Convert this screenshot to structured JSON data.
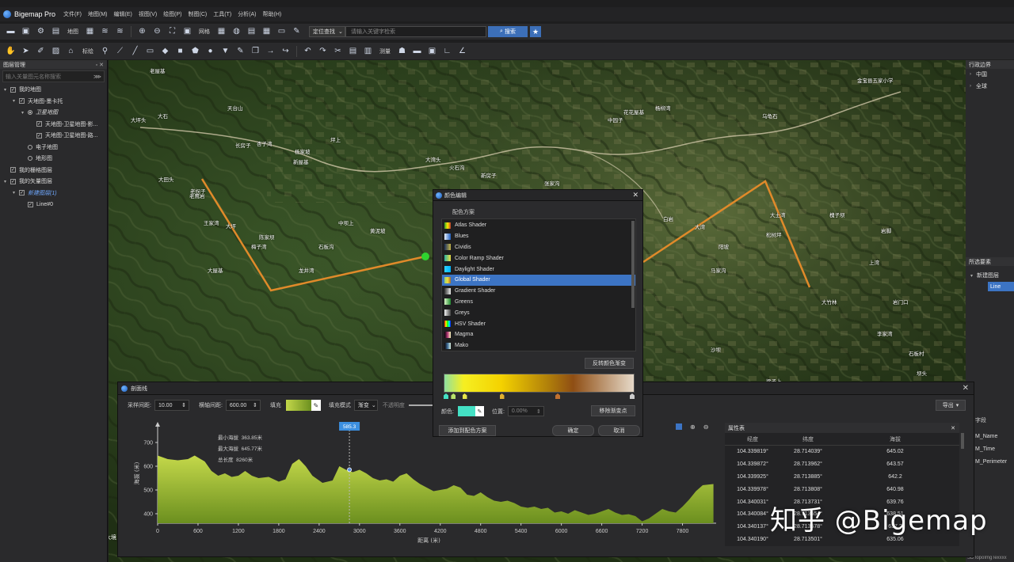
{
  "app": {
    "title": "Bigemap Pro",
    "menu": [
      "文件(F)",
      "地图(M)",
      "编辑(E)",
      "视图(V)",
      "绘图(P)",
      "制图(C)",
      "工具(T)",
      "分析(A)",
      "帮助(H)"
    ]
  },
  "toolbar1": {
    "map_label": "地图",
    "grid_label": "网格",
    "search_mode": "定位查找",
    "search_placeholder": "请输入关键字检索",
    "search_button": "搜索",
    "star_icon": "★"
  },
  "toolbar2": {
    "mark_label": "标绘",
    "measure_label": "测量"
  },
  "left_panel": {
    "title": "图层管理",
    "filter_placeholder": "输入关量图元名称搜索",
    "tree": [
      {
        "label": "我的地图",
        "level": 0,
        "type": "check",
        "arrow": "▾"
      },
      {
        "label": "天地图-墨卡托",
        "level": 1,
        "type": "check",
        "arrow": "▾"
      },
      {
        "label": "卫星地图",
        "level": 2,
        "type": "radio",
        "on": true,
        "arrow": "▾",
        "italic": true
      },
      {
        "label": "天地图-卫星地图-影...",
        "level": 3,
        "type": "check",
        "arrow": ""
      },
      {
        "label": "天地图-卫星地图-路...",
        "level": 3,
        "type": "check",
        "arrow": ""
      },
      {
        "label": "电子地图",
        "level": 2,
        "type": "radio",
        "on": false,
        "arrow": ""
      },
      {
        "label": "地形图",
        "level": 2,
        "type": "radio",
        "on": false,
        "arrow": ""
      },
      {
        "label": "我的栅格图层",
        "level": 0,
        "type": "check",
        "arrow": ""
      },
      {
        "label": "我的矢量图层",
        "level": 0,
        "type": "check",
        "arrow": "▾"
      },
      {
        "label": "新建图层(1)",
        "level": 1,
        "type": "check",
        "arrow": "▾",
        "italic": true,
        "color": "#6fa8ff"
      },
      {
        "label": "Line#0",
        "level": 2,
        "type": "check",
        "arrow": ""
      }
    ]
  },
  "right_panel": {
    "admin_title": "行政边界",
    "admin_items": [
      "中国",
      "全球"
    ],
    "selected_title": "所选要素",
    "selected_layer": "新建图层",
    "selected_item": "Line",
    "fields_title": "字段",
    "fields": [
      "M_Name",
      "M_Time",
      "M_Perimeter"
    ],
    "bottom_text": "SDTopoImgTexxxx"
  },
  "map_labels": [
    {
      "t": "老屋基"
    },
    {
      "t": "大石"
    },
    {
      "t": "大坪头"
    },
    {
      "t": "天台山"
    },
    {
      "t": "老拐子"
    },
    {
      "t": "王家湾"
    },
    {
      "t": "杏子湾"
    },
    {
      "t": "杨家坡"
    },
    {
      "t": "坪上"
    },
    {
      "t": "长房子"
    },
    {
      "t": "新屋基"
    },
    {
      "t": "大田头"
    },
    {
      "t": "老鹰岩"
    },
    {
      "t": "大坪"
    },
    {
      "t": "陈家坝"
    },
    {
      "t": "石板沟"
    },
    {
      "t": "梅子湾"
    },
    {
      "t": "大屋基"
    },
    {
      "t": "龙井湾"
    },
    {
      "t": "中坝上"
    },
    {
      "t": "黄泥坡"
    },
    {
      "t": "大湾头"
    },
    {
      "t": "火石沟"
    },
    {
      "t": "新房子"
    },
    {
      "t": "张家沟"
    },
    {
      "t": "竹林湾"
    },
    {
      "t": "水竹林"
    },
    {
      "t": "白岩"
    },
    {
      "t": "大湾"
    },
    {
      "t": "马家沟"
    },
    {
      "t": "中园子"
    },
    {
      "t": "花花屋基"
    },
    {
      "t": "杨柳湾"
    },
    {
      "t": "乌龟石"
    },
    {
      "t": "金宝县五家小学"
    },
    {
      "t": "大土湾"
    },
    {
      "t": "松树坪"
    },
    {
      "t": "大竹林"
    },
    {
      "t": "槐子坝"
    },
    {
      "t": "岩脚"
    },
    {
      "t": "上湾"
    },
    {
      "t": "岩门口"
    },
    {
      "t": "李家湾"
    },
    {
      "t": "石板村"
    },
    {
      "t": "坝头"
    },
    {
      "t": "梁子上"
    },
    {
      "t": "沙坝"
    },
    {
      "t": "阳坡"
    }
  ],
  "color_dialog": {
    "title": "颜色编辑",
    "scheme_label": "配色方案",
    "shaders": [
      {
        "name": "Atlas Shader",
        "sw": "linear-gradient(90deg,#2ca02c,#ffe800,#c0392b)"
      },
      {
        "name": "Blues",
        "sw": "linear-gradient(90deg,#eaf2ff,#1f5fbf)"
      },
      {
        "name": "Cividis",
        "sw": "linear-gradient(90deg,#1b2f5b,#c8b84a)"
      },
      {
        "name": "Color Ramp Shader",
        "sw": "linear-gradient(90deg,#2ab0a0,#f0e040)"
      },
      {
        "name": "Daylight Shader",
        "sw": "linear-gradient(90deg,#2fd3ff,#00b4ff)"
      },
      {
        "name": "Global Shader",
        "sw": "linear-gradient(90deg,#8fd07a,#f1dd3a,#a56a2a)"
      },
      {
        "name": "Gradient Shader",
        "sw": "linear-gradient(90deg,#333,#eee)"
      },
      {
        "name": "Greens",
        "sw": "linear-gradient(90deg,#d9f5c5,#1f8a2f)"
      },
      {
        "name": "Greys",
        "sw": "linear-gradient(90deg,#f2f2f2,#444)"
      },
      {
        "name": "HSV Shader",
        "sw": "linear-gradient(90deg,#f00,#ff0,#0f0,#0ff,#00f)"
      },
      {
        "name": "Magma",
        "sw": "linear-gradient(90deg,#000004,#b73779,#fcfdbf)"
      },
      {
        "name": "Mako",
        "sw": "linear-gradient(90deg,#0b0405,#3e6e9a,#def5e5)"
      }
    ],
    "selected_index": 5,
    "reverse_button": "反转颜色渐变",
    "color_label": "颜色:",
    "position_label": "位置:",
    "position_value": "0.00%",
    "remove_stop_button": "移除渐变点",
    "add_scheme_button": "添加到配色方案",
    "ok_button": "确定",
    "cancel_button": "取消",
    "stop_positions": [
      0,
      0.04,
      0.1,
      0.3,
      0.6,
      1.0
    ]
  },
  "profile": {
    "title": "剖面线",
    "sample_label": "采样间距:",
    "sample_value": "10.00",
    "hgrid_label": "横轴间距:",
    "hgrid_value": "600.00",
    "fill_label": "填充",
    "fill_mode_label": "填充模式",
    "fill_mode_value": "渐变",
    "opacity_label": "不透明度",
    "export_button": "导出",
    "stats": [
      {
        "label": "最小海拔",
        "value": "363.85米"
      },
      {
        "label": "最大海拔",
        "value": "645.77米"
      },
      {
        "label": "总长度",
        "value": "8260米"
      }
    ],
    "tooltip": "585.3",
    "props_title": "属性表",
    "columns": [
      "经度",
      "纬度",
      "海拔"
    ],
    "rows": [
      [
        "104.339819°",
        "28.714039°",
        "645.02"
      ],
      [
        "104.339872°",
        "28.713962°",
        "643.57"
      ],
      [
        "104.339925°",
        "28.713885°",
        "642.2"
      ],
      [
        "104.339978°",
        "28.713808°",
        "640.98"
      ],
      [
        "104.340031°",
        "28.713731°",
        "639.76"
      ],
      [
        "104.340084°",
        "28.713654°",
        "638.51"
      ],
      [
        "104.340137°",
        "28.713578°",
        "637.2"
      ],
      [
        "104.340190°",
        "28.713501°",
        "635.06"
      ]
    ]
  },
  "chart_data": {
    "type": "area",
    "xlabel": "距离 (米)",
    "ylabel": "海拔 (米)",
    "xlim": [
      0,
      8300
    ],
    "ylim": [
      360,
      780
    ],
    "x_ticks": [
      0,
      600,
      1200,
      1800,
      2400,
      3000,
      3600,
      4200,
      4800,
      5400,
      6000,
      6600,
      7200,
      7800
    ],
    "y_ticks": [
      400,
      500,
      600,
      700
    ],
    "x": [
      0,
      150,
      300,
      450,
      550,
      700,
      800,
      900,
      1000,
      1100,
      1200,
      1300,
      1400,
      1500,
      1650,
      1800,
      1900,
      2000,
      2100,
      2200,
      2300,
      2450,
      2600,
      2700,
      2800,
      2900,
      3000,
      3100,
      3200,
      3300,
      3400,
      3500,
      3600,
      3700,
      3800,
      3900,
      4000,
      4100,
      4200,
      4300,
      4400,
      4500,
      4600,
      4700,
      4800,
      4900,
      5000,
      5100,
      5200,
      5300,
      5400,
      5500,
      5600,
      5700,
      5800,
      5900,
      6000,
      6100,
      6200,
      6300,
      6400,
      6500,
      6600,
      6700,
      6800,
      6900,
      7000,
      7100,
      7200,
      7300,
      7400,
      7500,
      7600,
      7700,
      7800,
      7900,
      8000,
      8100,
      8260
    ],
    "y": [
      645,
      630,
      625,
      630,
      645,
      620,
      580,
      560,
      570,
      555,
      560,
      580,
      560,
      550,
      555,
      535,
      545,
      610,
      630,
      600,
      560,
      530,
      540,
      600,
      585,
      575,
      585,
      570,
      550,
      540,
      545,
      535,
      560,
      570,
      545,
      525,
      510,
      495,
      500,
      505,
      520,
      510,
      480,
      475,
      490,
      470,
      455,
      450,
      455,
      445,
      430,
      425,
      430,
      420,
      425,
      405,
      410,
      400,
      415,
      405,
      395,
      400,
      410,
      420,
      405,
      395,
      398,
      390,
      368,
      380,
      400,
      420,
      410,
      405,
      430,
      460,
      495,
      520,
      525
    ],
    "marker": {
      "x": 2850,
      "y": 585.3
    },
    "title": "",
    "grid": false
  },
  "watermark": "知乎 @Bigemap",
  "colors": {
    "accent": "#3c74c4",
    "route": "#e08a2a",
    "fill_top": "#c4d84a",
    "fill_bottom": "#6b8f1f"
  }
}
